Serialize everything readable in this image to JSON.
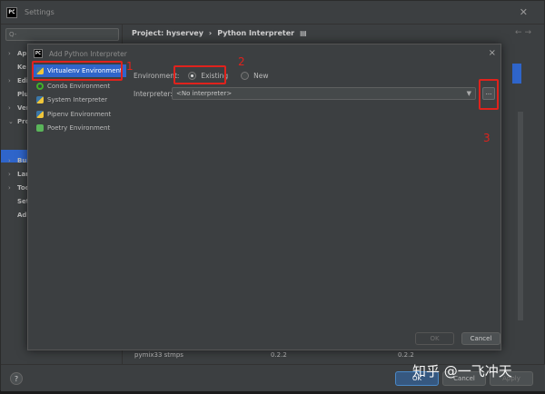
{
  "settings": {
    "title": "Settings",
    "search_placeholder": "Q-",
    "tree": [
      {
        "label": "Ap",
        "arrow": "›"
      },
      {
        "label": "Ke",
        "arrow": ""
      },
      {
        "label": "Edi",
        "arrow": "›"
      },
      {
        "label": "Plu",
        "arrow": ""
      },
      {
        "label": "Ver",
        "arrow": "›"
      },
      {
        "label": "Pro",
        "arrow": "⌄"
      },
      {
        "label": "Bui",
        "arrow": "›"
      },
      {
        "label": "Lar",
        "arrow": "›"
      },
      {
        "label": "Toc",
        "arrow": "›"
      },
      {
        "label": "Set",
        "arrow": ""
      },
      {
        "label": "Ad",
        "arrow": ""
      }
    ],
    "breadcrumb": {
      "project": "Project: hyservey",
      "separator": "›",
      "page": "Python Interpreter",
      "icon": "▤"
    },
    "nav_arrows": "←  →",
    "package_row": {
      "name": "pymix33 stmps",
      "version": "0.2.2",
      "latest": "0.2.2"
    },
    "buttons": {
      "ok": "OK",
      "cancel": "Cancel",
      "apply": "Apply"
    },
    "help": "?"
  },
  "dialog": {
    "title": "Add Python Interpreter",
    "close": "×",
    "environments": [
      {
        "label": "Virtualenv Environment",
        "icon": "python-icon",
        "selected": true
      },
      {
        "label": "Conda Environment",
        "icon": "conda-icon",
        "selected": false
      },
      {
        "label": "System Interpreter",
        "icon": "python-icon",
        "selected": false
      },
      {
        "label": "Pipenv Environment",
        "icon": "python-icon",
        "selected": false
      },
      {
        "label": "Poetry Environment",
        "icon": "poetry-icon",
        "selected": false
      }
    ],
    "environment_label": "Environment:",
    "radio_existing": "Existing",
    "radio_new": "New",
    "interpreter_label": "Interpreter:",
    "interpreter_value": "<No interpreter>",
    "browse_label": "...",
    "ok": "OK",
    "cancel": "Cancel"
  },
  "annotations": {
    "one": "1",
    "two": "2",
    "three": "3",
    "color": "#e0221c"
  },
  "watermark": "知乎 @一飞冲天",
  "colors": {
    "accent": "#2f65ca",
    "background": "#3c3f41",
    "annotation": "#e0221c"
  }
}
